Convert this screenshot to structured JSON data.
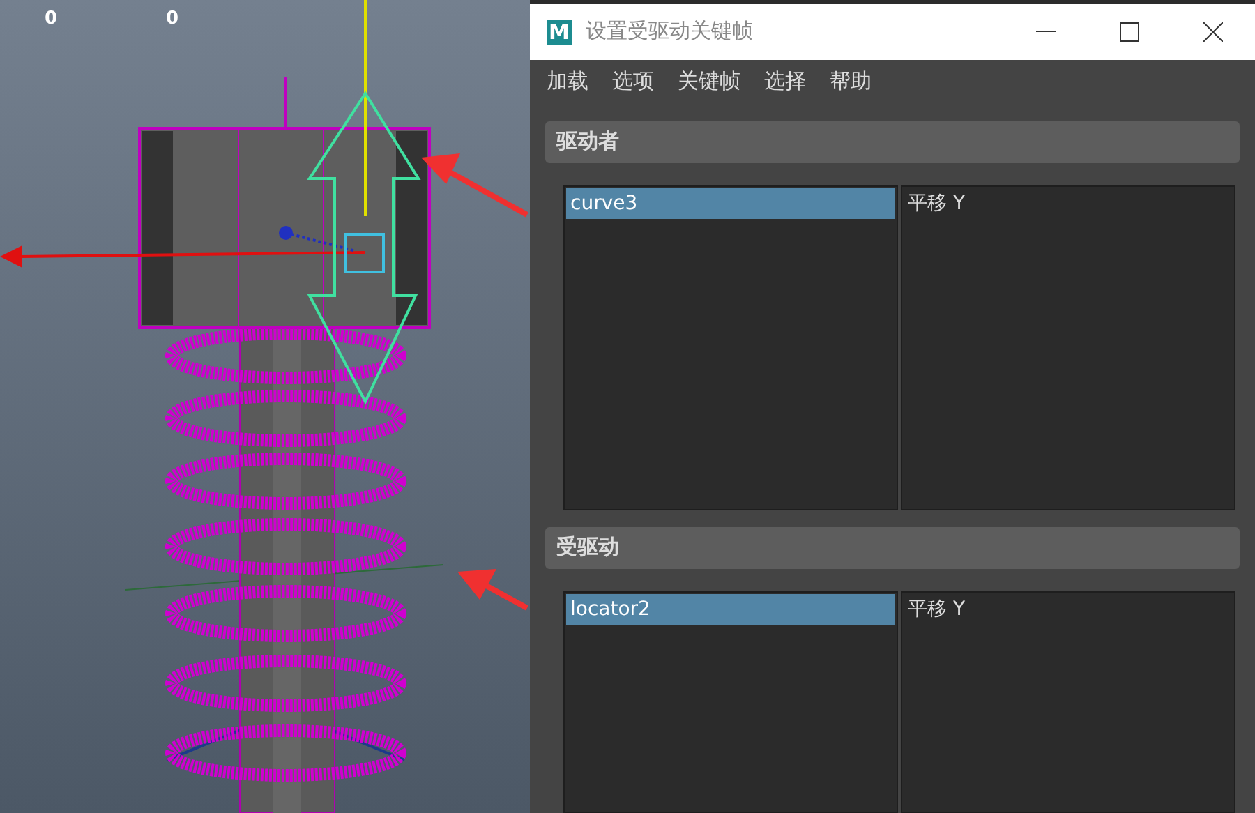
{
  "viewport": {
    "hud_values": [
      "0",
      "0"
    ]
  },
  "window": {
    "logo": "M",
    "title": "设置受驱动关键帧"
  },
  "menu": [
    {
      "label": "加载"
    },
    {
      "label": "选项"
    },
    {
      "label": "关键帧"
    },
    {
      "label": "选择"
    },
    {
      "label": "帮助"
    }
  ],
  "sections": [
    {
      "title": "驱动者",
      "objects": [
        {
          "label": "curve3",
          "selected": true
        }
      ],
      "attributes": [
        {
          "label": "平移 Y",
          "selected": false
        }
      ]
    },
    {
      "title": "受驱动",
      "objects": [
        {
          "label": "locator2",
          "selected": true
        }
      ],
      "attributes": [
        {
          "label": "平移 Y",
          "selected": false
        }
      ]
    }
  ]
}
